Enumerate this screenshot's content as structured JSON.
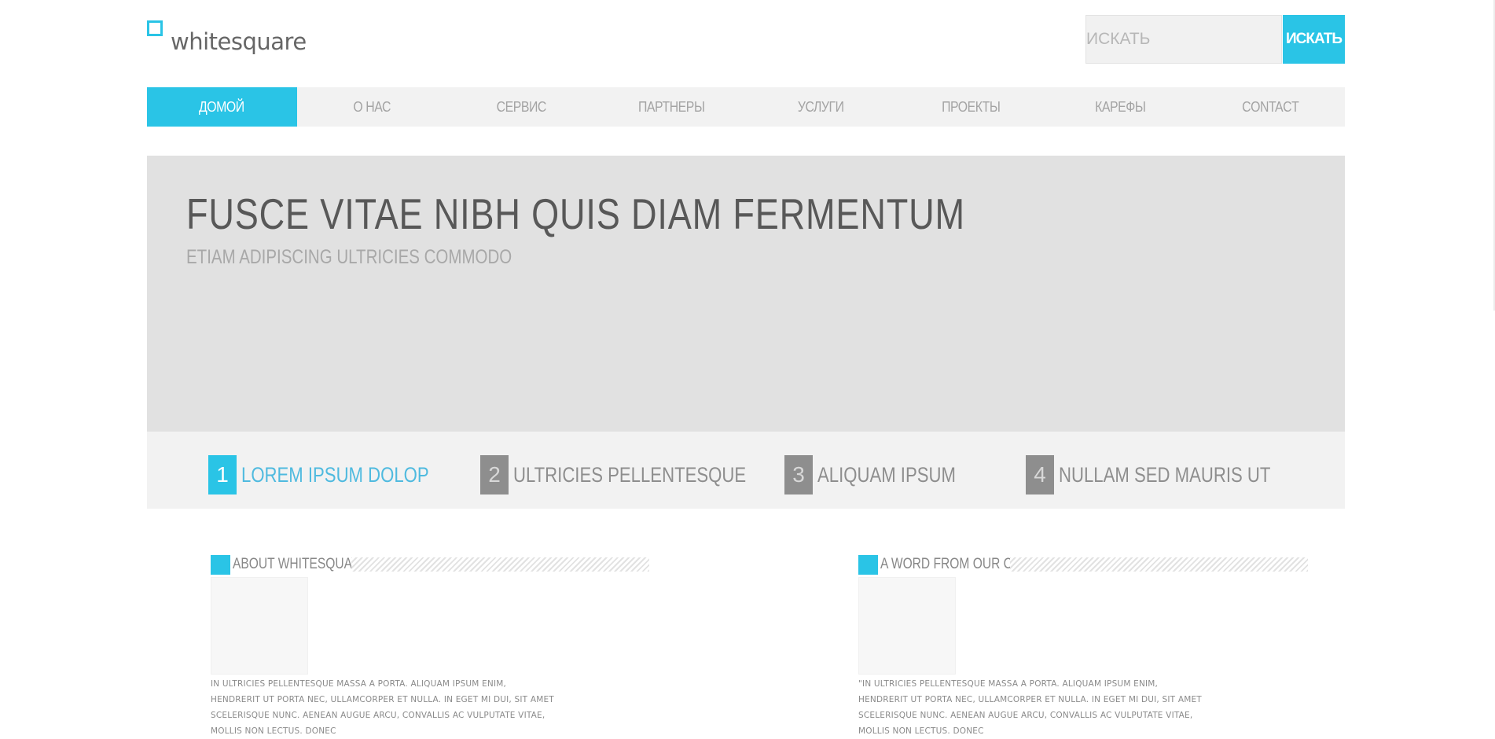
{
  "logo": {
    "text": "whitesquare"
  },
  "search": {
    "placeholder": "ИСКАТЬ",
    "button_label": "ИСКАТЬ"
  },
  "nav": {
    "items": [
      {
        "label": "ДОМОЙ",
        "active": true
      },
      {
        "label": "О НАС"
      },
      {
        "label": "СЕРВИС"
      },
      {
        "label": "ПАРТНЕРЫ"
      },
      {
        "label": "УСЛУГИ"
      },
      {
        "label": "ПРОЕКТЫ"
      },
      {
        "label": "КАРЕФЫ"
      },
      {
        "label": "CONTACT"
      }
    ]
  },
  "hero": {
    "title": "FUSCE VITAE NIBH QUIS DIAM FERMENTUM",
    "subtitle": "ETIAM ADIPISCING ULTRICIES COMMODO"
  },
  "features": [
    {
      "num": "1",
      "label": "LOREM IPSUM DOLOP",
      "active": true
    },
    {
      "num": "2",
      "label": "ULTRICIES PELLENTESQUE"
    },
    {
      "num": "3",
      "label": "ALIQUAM IPSUM"
    },
    {
      "num": "4",
      "label": "NULLAM SED MAURIS UT"
    }
  ],
  "about": {
    "title": "ABOUT WHITESQUARE",
    "text": "IN ULTRICIES PELLENTESQUE MASSA A PORTA. ALIQUAM IPSUM ENIM, HENDRERIT UT PORTA NEC, ULLAMCORPER ET NULLA. IN EGET MI DUI, SIT AMET SCELERISQUE NUNC. AENEAN AUGUE ARCU, CONVALLIS AC VULPUTATE VITAE, MOLLIS NON LECTUS. DONEC"
  },
  "ceo": {
    "title": "A WORD FROM OUR CEO",
    "text": "\"IN ULTRICIES PELLENTESQUE MASSA A PORTA. ALIQUAM IPSUM ENIM, HENDRERIT UT PORTA NEC, ULLAMCORPER ET NULLA. IN EGET MI DUI, SIT AMET SCELERISQUE NUNC. AENEAN AUGUE ARCU, CONVALLIS AC VULPUTATE VITAE, MOLLIS NON LECTUS. DONEC"
  },
  "colors": {
    "accent": "#2ac4e6",
    "nav_bg": "#f2f2f2",
    "hero_bg": "#e1e1e1"
  }
}
